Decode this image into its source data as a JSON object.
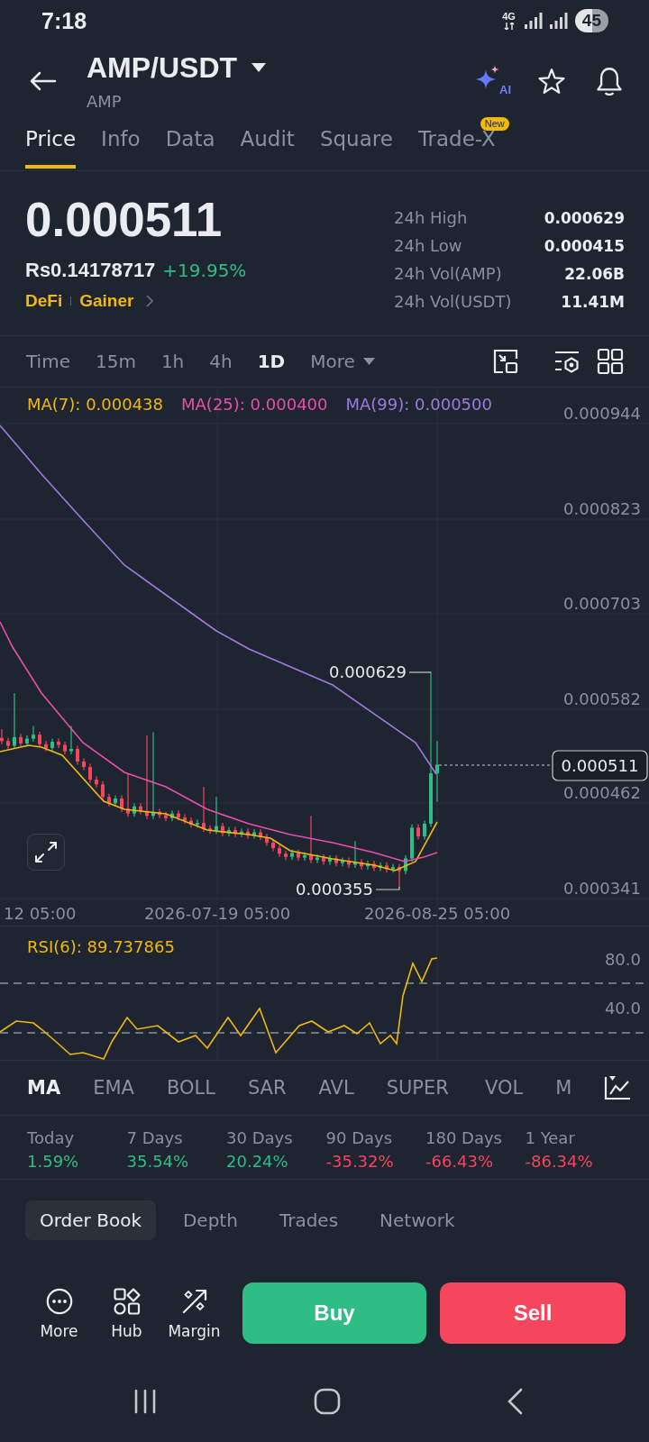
{
  "status_bar": {
    "time": "7:18",
    "network": "4G",
    "battery": "45"
  },
  "header": {
    "pair": "AMP/USDT",
    "subtitle": "AMP",
    "ai_label": "AI"
  },
  "tabs": [
    {
      "label": "Price",
      "selected": true
    },
    {
      "label": "Info",
      "selected": false
    },
    {
      "label": "Data",
      "selected": false
    },
    {
      "label": "Audit",
      "selected": false
    },
    {
      "label": "Square",
      "selected": false
    },
    {
      "label": "Trade-X",
      "selected": false,
      "badge": "New"
    }
  ],
  "ticker": {
    "last_price": "0.000511",
    "fiat_price": "Rs0.14178717",
    "change": "+19.95%",
    "positive": true,
    "tags": [
      "DeFi",
      "Gainer"
    ]
  },
  "stats": [
    {
      "label": "24h High",
      "value": "0.000629"
    },
    {
      "label": "24h Low",
      "value": "0.000415"
    },
    {
      "label": "24h Vol(AMP)",
      "value": "22.06B"
    },
    {
      "label": "24h Vol(USDT)",
      "value": "11.41M"
    }
  ],
  "intervals": [
    {
      "label": "Time",
      "selected": false,
      "kind": "option"
    },
    {
      "label": "15m",
      "selected": false,
      "kind": "option"
    },
    {
      "label": "1h",
      "selected": false,
      "kind": "option"
    },
    {
      "label": "4h",
      "selected": false,
      "kind": "option"
    },
    {
      "label": "1D",
      "selected": true,
      "kind": "option"
    },
    {
      "label": "More",
      "selected": false,
      "kind": "dropdown"
    }
  ],
  "chart": {
    "legend": [
      {
        "label": "MA(7): 0.000438",
        "color": "#f0b90b"
      },
      {
        "label": "MA(25): 0.000400",
        "color": "#e84fad"
      },
      {
        "label": "MA(99): 0.000500",
        "color": "#9f7ae0"
      }
    ],
    "price_axis": [
      "0.000944",
      "0.000823",
      "0.000703",
      "0.000582",
      "0.000462",
      "0.000341"
    ],
    "date_axis": [
      "12 05:00",
      "2026-07-19 05:00",
      "2026-08-25 05:00"
    ],
    "high_label": "0.000629",
    "low_label": "0.000355",
    "last_price_tag": "0.000511"
  },
  "rsi": {
    "legend": "RSI(6): 89.737865",
    "axis": [
      "80.0",
      "40.0"
    ]
  },
  "overlay_indicators": [
    {
      "label": "MA",
      "selected": true
    },
    {
      "label": "EMA",
      "selected": false
    },
    {
      "label": "BOLL",
      "selected": false
    },
    {
      "label": "SAR",
      "selected": false
    },
    {
      "label": "AVL",
      "selected": false
    },
    {
      "label": "SUPER",
      "selected": false
    }
  ],
  "sub_indicators": [
    {
      "label": "VOL",
      "selected": false
    },
    {
      "label": "M",
      "selected": false
    }
  ],
  "performance": [
    {
      "period": "Today",
      "change": "1.59%",
      "positive": true
    },
    {
      "period": "7 Days",
      "change": "35.54%",
      "positive": true
    },
    {
      "period": "30 Days",
      "change": "20.24%",
      "positive": true
    },
    {
      "period": "90 Days",
      "change": "-35.32%",
      "positive": false
    },
    {
      "period": "180 Days",
      "change": "-66.43%",
      "positive": false
    },
    {
      "period": "1 Year",
      "change": "-86.34%",
      "positive": false
    }
  ],
  "book_tabs": [
    {
      "label": "Order Book",
      "selected": true
    },
    {
      "label": "Depth",
      "selected": false
    },
    {
      "label": "Trades",
      "selected": false
    },
    {
      "label": "Network",
      "selected": false
    }
  ],
  "actions": [
    {
      "label": "More",
      "kind": "more"
    },
    {
      "label": "Hub",
      "kind": "hub"
    },
    {
      "label": "Margin",
      "kind": "margin"
    }
  ],
  "trade_buttons": [
    {
      "label": "Buy",
      "kind": "buy"
    },
    {
      "label": "Sell",
      "kind": "sell"
    }
  ]
}
